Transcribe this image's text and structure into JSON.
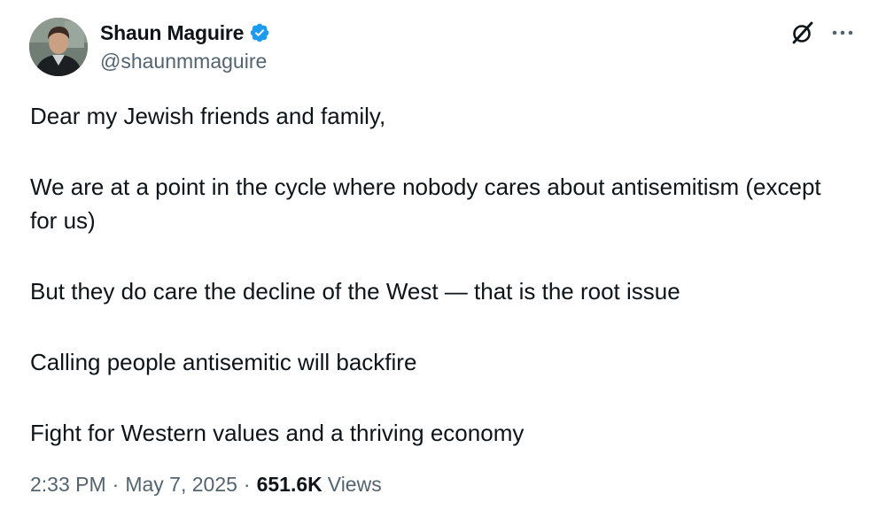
{
  "author": {
    "display_name": "Shaun Maguire",
    "handle": "@shaunmmaguire",
    "verified": true
  },
  "icons": {
    "avatar": "profile-photo",
    "verified": "verified-badge-icon",
    "grok": "grok-icon",
    "more": "more-options-icon"
  },
  "tweet": {
    "paragraphs": [
      "Dear my Jewish friends and family,",
      "We are at a point in the cycle where nobody cares about antisemitism (except for us)",
      "But they do care the decline of the West — that is the root issue",
      "Calling people antisemitic will backfire",
      "Fight for Western values and a thriving economy"
    ]
  },
  "meta": {
    "time": "2:33 PM",
    "separator": "·",
    "date": "May 7, 2025",
    "views_count": "651.6K",
    "views_label": "Views"
  },
  "colors": {
    "text": "#0f1419",
    "secondary": "#536471",
    "verified_blue": "#1d9bf0"
  }
}
